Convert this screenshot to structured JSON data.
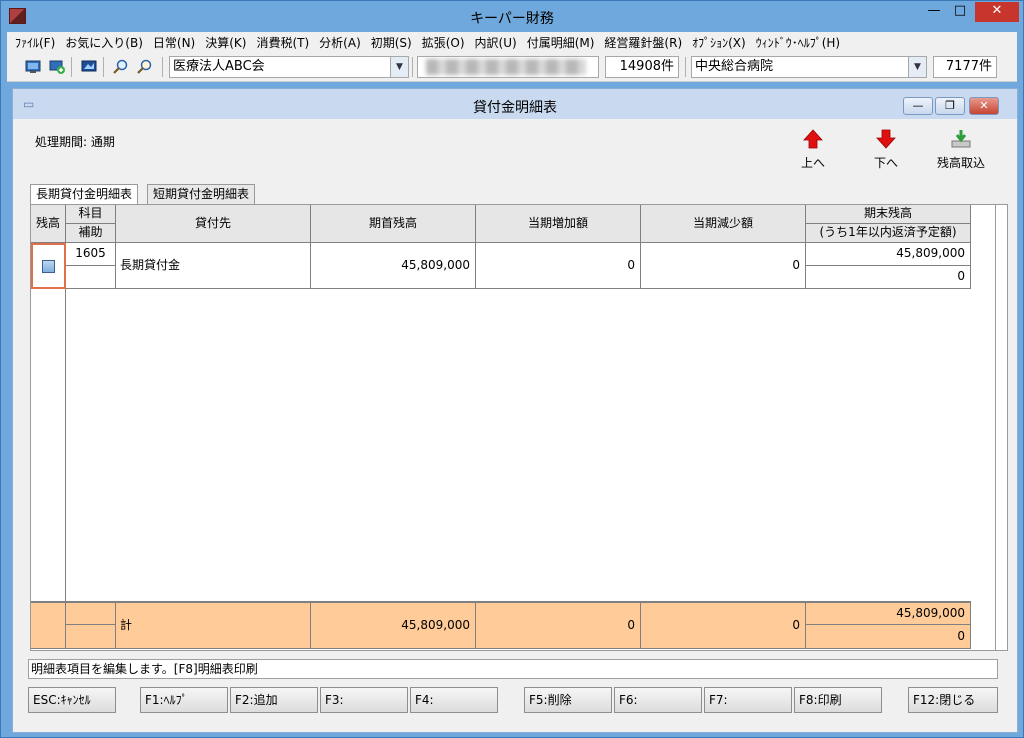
{
  "app": {
    "title": "キーパー財務"
  },
  "menu": [
    "ﾌｧｲﾙ(F)",
    "お気に入り(B)",
    "日常(N)",
    "決算(K)",
    "消費税(T)",
    "分析(A)",
    "初期(S)",
    "拡張(O)",
    "内訳(U)",
    "付属明細(M)",
    "経営羅針盤(R)",
    "ｵﾌﾟｼｮﾝ(X)",
    "ｳｨﾝﾄﾞｳ･ﾍﾙﾌﾟ(H)"
  ],
  "toolbar": {
    "corp_name": "医療法人ABC会",
    "corp_count": "14908件",
    "facility_name": "中央総合病院",
    "facility_count": "7177件"
  },
  "child": {
    "title": "貸付金明細表",
    "period_label": "処理期間: 通期",
    "buttons": {
      "up": "上へ",
      "down": "下へ",
      "import": "残高取込"
    }
  },
  "tabs": [
    "長期貸付金明細表",
    "短期貸付金明細表"
  ],
  "table": {
    "headers": {
      "zandaka": "残高",
      "kamoku": "科目",
      "hojo": "補助",
      "kashitsuke": "貸付先",
      "kishu": "期首残高",
      "zouka": "当期増加額",
      "genshou": "当期減少額",
      "kimatsu": "期末残高",
      "kimatsu_sub": "(うち1年以内返済予定額)"
    },
    "rows": [
      {
        "kamoku": "1605",
        "hojo": "",
        "kashitsuke": "長期貸付金",
        "kishu": "45,809,000",
        "zouka": "0",
        "genshou": "0",
        "kimatsu": "45,809,000",
        "kimatsu_sub": "0"
      }
    ],
    "total": {
      "label": "計",
      "kishu": "45,809,000",
      "zouka": "0",
      "genshou": "0",
      "kimatsu": "45,809,000",
      "kimatsu_sub": "0"
    }
  },
  "status": "明細表項目を編集します。[F8]明細表印刷",
  "fkeys": [
    "ESC:ｷｬﾝｾﾙ",
    "F1:ﾍﾙﾌﾟ",
    "F2:追加",
    "F3:",
    "F4:",
    "F5:削除",
    "F6:",
    "F7:",
    "F8:印刷",
    "F12:閉じる"
  ]
}
